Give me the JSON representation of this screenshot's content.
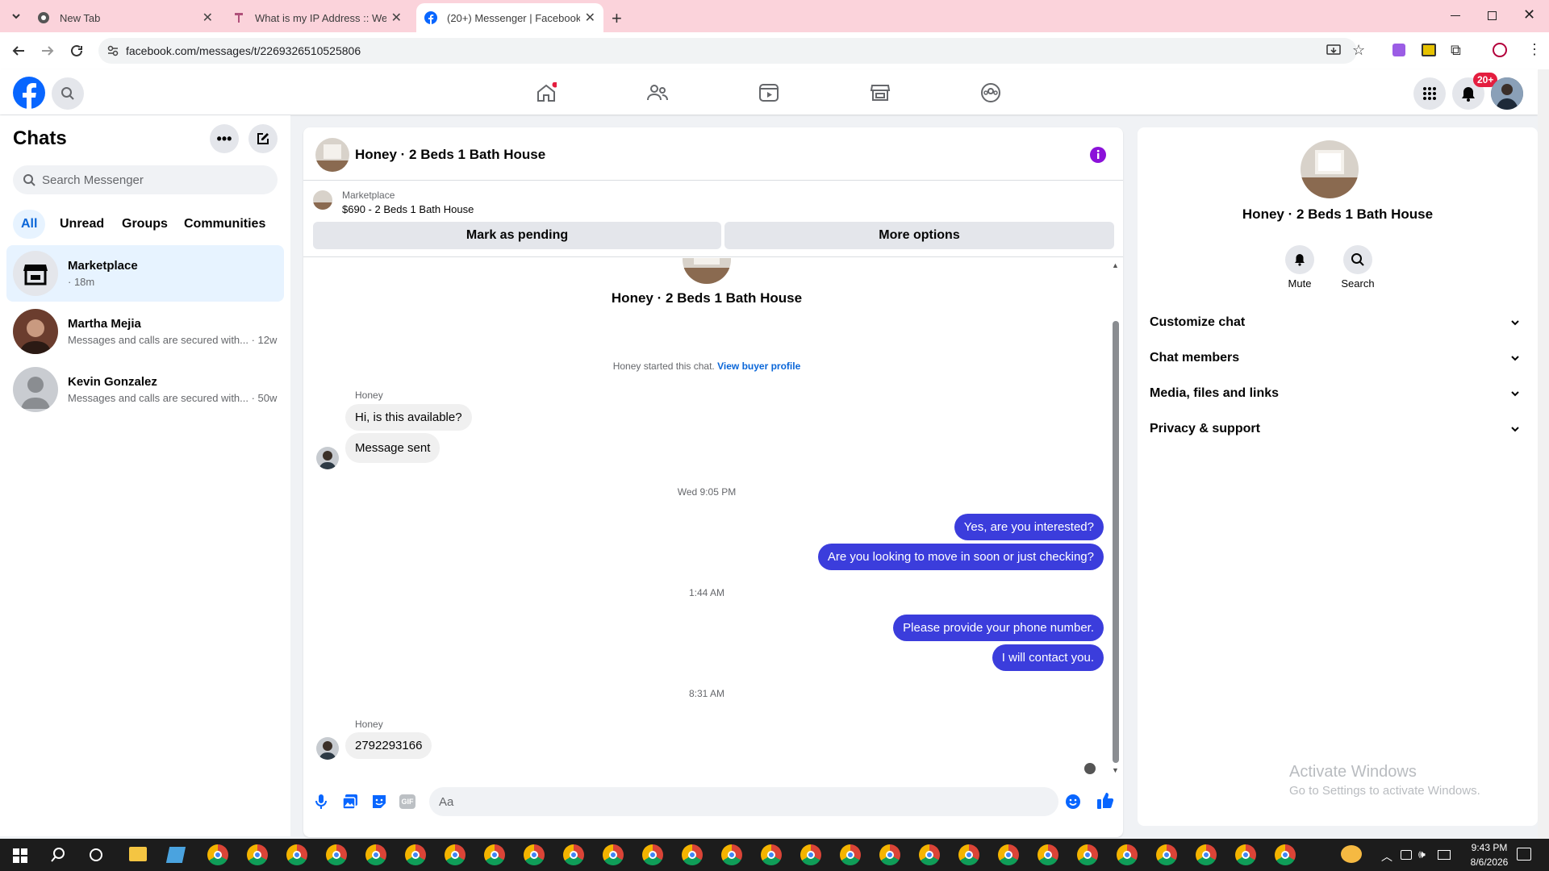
{
  "browser": {
    "tabs": [
      {
        "title": "New Tab",
        "icon": "chrome-icon"
      },
      {
        "title": "What is my IP Address :: WebBr",
        "icon": "webbrowser-icon"
      },
      {
        "title": "(20+) Messenger | Facebook",
        "icon": "facebook-icon"
      }
    ],
    "url": "facebook.com/messages/t/2269326510525806"
  },
  "header": {
    "notification_badge": "20+"
  },
  "sidebar": {
    "title": "Chats",
    "search_placeholder": "Search Messenger",
    "filters": [
      "All",
      "Unread",
      "Groups",
      "Communities"
    ],
    "chats": [
      {
        "name": "Marketplace",
        "preview": "· 18m"
      },
      {
        "name": "Martha Mejia",
        "preview": "Messages and calls are secured with... · 12w"
      },
      {
        "name": "Kevin Gonzalez",
        "preview": "Messages and calls are secured with... · 50w"
      }
    ]
  },
  "conversation": {
    "title": "Honey · 2 Beds 1 Bath House",
    "listing_source": "Marketplace",
    "listing": "$690 - 2 Beds 1 Bath House",
    "mark_pending": "Mark as pending",
    "more_options": "More options",
    "profile_name": "Honey · 2 Beds 1 Bath House",
    "started_text": "Honey started this chat.",
    "view_buyer": "View buyer profile",
    "sender1": "Honey",
    "msg_in_1": "Hi, is this available?",
    "msg_in_2": "Message sent",
    "time1": "Wed 9:05 PM",
    "msg_out_1": "Yes, are you interested?",
    "msg_out_2": "Are you looking to move in soon or just checking?",
    "time2": "1:44 AM",
    "msg_out_3": "Please provide your phone number.",
    "msg_out_4": "I will contact you.",
    "time3": "8:31 AM",
    "sender2": "Honey",
    "msg_in_3": "2792293166",
    "composer_placeholder": "Aa"
  },
  "details": {
    "name": "Honey · 2 Beds 1 Bath House",
    "mute": "Mute",
    "search": "Search",
    "sections": [
      "Customize chat",
      "Chat members",
      "Media, files and links",
      "Privacy & support"
    ]
  },
  "watermark": {
    "title": "Activate Windows",
    "sub": "Go to Settings to activate Windows."
  },
  "taskbar": {
    "time": "9:43 PM",
    "date": "8/6/2026"
  },
  "colors": {
    "accent": "#0866ff",
    "outgoing": "#3b3ddc",
    "tabstrip": "#fbd3db",
    "info": "#8b11d9"
  }
}
